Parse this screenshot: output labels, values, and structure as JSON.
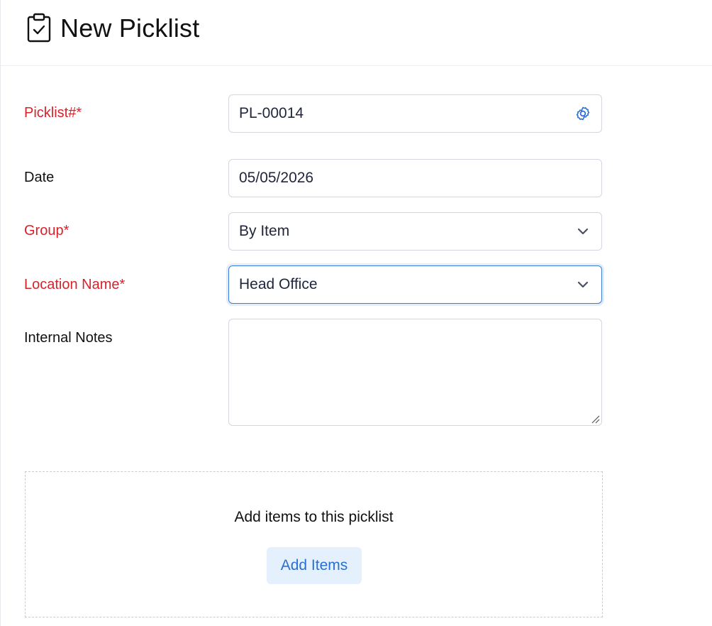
{
  "header": {
    "title": "New Picklist",
    "icon": "clipboard-check-icon"
  },
  "form": {
    "picklist_number": {
      "label": "Picklist#*",
      "value": "PL-00014",
      "trail_icon": "gear-icon"
    },
    "date": {
      "label": "Date",
      "value": "05/05/2026"
    },
    "group": {
      "label": "Group*",
      "value": "By Item",
      "trail_icon": "chevron-down-icon"
    },
    "location_name": {
      "label": "Location Name*",
      "value": "Head Office",
      "trail_icon": "chevron-down-icon"
    },
    "internal_notes": {
      "label": "Internal Notes",
      "value": ""
    }
  },
  "items_section": {
    "prompt": "Add items to this picklist",
    "button_label": "Add Items"
  },
  "colors": {
    "required_label": "#d6232b",
    "accent": "#2a6fd1",
    "button_bg": "#e4f0fc",
    "focus_border": "#3a7dd8"
  }
}
